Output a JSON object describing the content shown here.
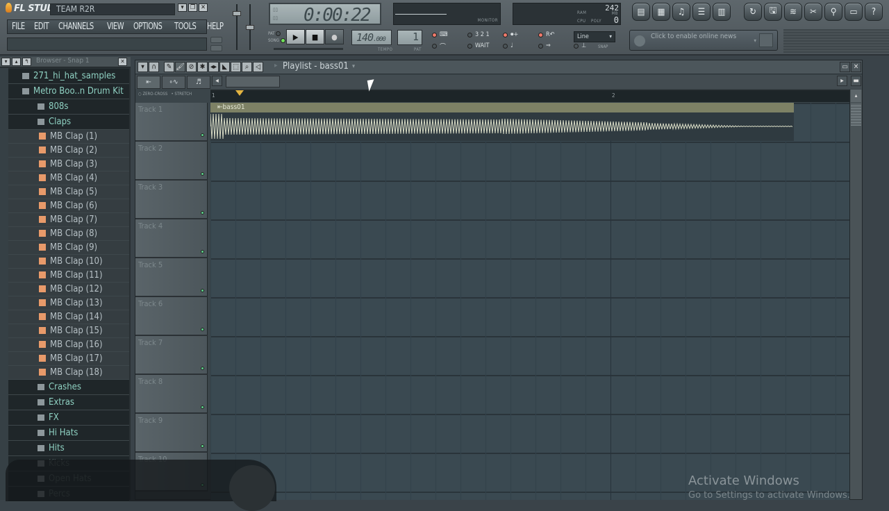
{
  "app": {
    "logo": "FL STUDIO",
    "title": "TEAM R2R"
  },
  "window_buttons": [
    "▾",
    "❐",
    "✕"
  ],
  "menu": [
    "FILE",
    "EDIT",
    "CHANNELS",
    "VIEW",
    "OPTIONS",
    "TOOLS",
    "HELP"
  ],
  "transport": {
    "time": "0:00:22",
    "pat_label": "PAT",
    "song_label": "SONG",
    "mode": "SONG",
    "play": "▶",
    "stop": "■",
    "record": "●",
    "tempo_int": "140",
    "tempo_dec": ".000",
    "tempo_label": "TEMPO",
    "pattern": "1",
    "pattern_label": "PAT",
    "monitor_label": "MONITOR",
    "ram_label": "RAM",
    "mb_label": "MB",
    "ram_value": "242",
    "cpu_label": "CPU",
    "poly_label": "POLY",
    "poly_value": "0"
  },
  "record_options": {
    "row1": [
      "⌨",
      "3 2 1",
      "⏺+",
      "R↶",
      "⇄"
    ],
    "row2": [
      "⌒",
      "WAIT",
      "♩",
      "⇒",
      "⊥"
    ]
  },
  "snap": {
    "value": "Line",
    "label": "SNAP"
  },
  "toolbar_icons": [
    "playlist-icon",
    "step-sequencer-icon",
    "piano-roll-icon",
    "browser-icon",
    "mixer-icon",
    "undo-icon",
    "save-icon",
    "export-wave-icon",
    "cut-tool-icon",
    "mic-icon",
    "document-icon",
    "help-icon"
  ],
  "news": {
    "text": "Click to enable online news"
  },
  "browser": {
    "title": "Browser - Snap 1",
    "items": [
      {
        "label": "271_hi_hat_samples",
        "type": "folder"
      },
      {
        "label": "Metro Boo..n Drum Kit",
        "type": "folder"
      },
      {
        "label": "808s",
        "type": "folder"
      },
      {
        "label": "Claps",
        "type": "folder"
      },
      {
        "label": "MB Clap (1)",
        "type": "file"
      },
      {
        "label": "MB Clap (2)",
        "type": "file"
      },
      {
        "label": "MB Clap (3)",
        "type": "file"
      },
      {
        "label": "MB Clap (4)",
        "type": "file"
      },
      {
        "label": "MB Clap (5)",
        "type": "file"
      },
      {
        "label": "MB Clap (6)",
        "type": "file"
      },
      {
        "label": "MB Clap (7)",
        "type": "file"
      },
      {
        "label": "MB Clap (8)",
        "type": "file"
      },
      {
        "label": "MB Clap (9)",
        "type": "file"
      },
      {
        "label": "MB Clap (10)",
        "type": "file"
      },
      {
        "label": "MB Clap (11)",
        "type": "file"
      },
      {
        "label": "MB Clap (12)",
        "type": "file"
      },
      {
        "label": "MB Clap (13)",
        "type": "file"
      },
      {
        "label": "MB Clap (14)",
        "type": "file"
      },
      {
        "label": "MB Clap (15)",
        "type": "file"
      },
      {
        "label": "MB Clap (16)",
        "type": "file"
      },
      {
        "label": "MB Clap (17)",
        "type": "file"
      },
      {
        "label": "MB Clap (18)",
        "type": "file"
      },
      {
        "label": "Crashes",
        "type": "folder"
      },
      {
        "label": "Extras",
        "type": "folder"
      },
      {
        "label": "FX",
        "type": "folder"
      },
      {
        "label": "Hi Hats",
        "type": "folder"
      },
      {
        "label": "Hits",
        "type": "folder"
      },
      {
        "label": "Kicks",
        "type": "folder"
      },
      {
        "label": "Open Hats",
        "type": "folder"
      },
      {
        "label": "Percs",
        "type": "folder"
      }
    ]
  },
  "playlist": {
    "title": "Playlist - bass01",
    "zero_cross": "ZERO-CROSS",
    "stretch": "STRETCH",
    "ruler": [
      "1",
      "2"
    ],
    "clip_name": "bass01",
    "tracks": [
      "Track 1",
      "Track 2",
      "Track 3",
      "Track 4",
      "Track 5",
      "Track 6",
      "Track 7",
      "Track 8",
      "Track 9",
      "Track 10"
    ]
  },
  "watermark": {
    "title": "Activate Windows",
    "subtitle": "Go to Settings to activate Windows."
  }
}
